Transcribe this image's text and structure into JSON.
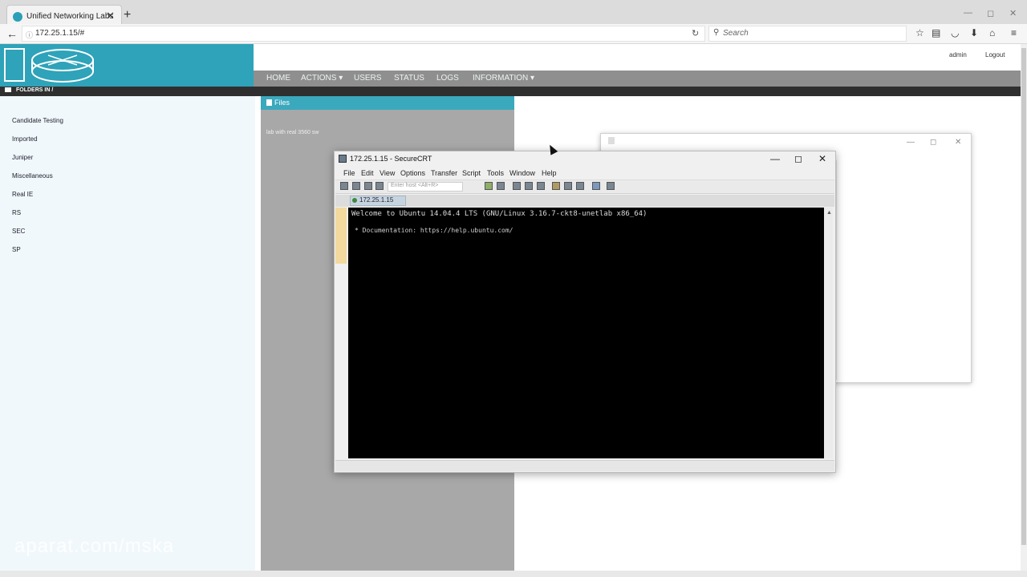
{
  "browser": {
    "tab_title": "Unified Networking Labs",
    "tab_close": "✕",
    "new_tab": "+",
    "url": "172.25.1.15/#",
    "search_placeholder": "Search",
    "back_icon": "←",
    "reload_icon": "↻",
    "minimize": "—",
    "maximize": "◻",
    "close": "✕"
  },
  "unl": {
    "nav": [
      "HOME",
      "ACTIONS ▾",
      "USERS",
      "STATUS",
      "LOGS",
      "INFORMATION ▾"
    ],
    "user": "admin",
    "logout": "Logout",
    "folders_title": "FOLDERS IN /",
    "folders": [
      "Candidate Testing",
      "Imported",
      "Juniper",
      "Miscellaneous",
      "Real IE",
      "RS",
      "SEC",
      "SP"
    ],
    "files_title": "Files",
    "file_item": "lab with real 3560 sw",
    "watermark": "aparat.com/mska"
  },
  "securecrt": {
    "title": "172.25.1.15 - SecureCRT",
    "menu": [
      "File",
      "Edit",
      "View",
      "Options",
      "Transfer",
      "Script",
      "Tools",
      "Window",
      "Help"
    ],
    "enter_host": "Enter host <Alt+R>",
    "session_tab": "172.25.1.15",
    "terminal": {
      "line1": "Welcome to Ubuntu 14.04.4 LTS (GNU/Linux 3.16.7-ckt8-unetlab x86_64)",
      "line2": "* Documentation:  https://help.ubuntu.com/"
    }
  }
}
